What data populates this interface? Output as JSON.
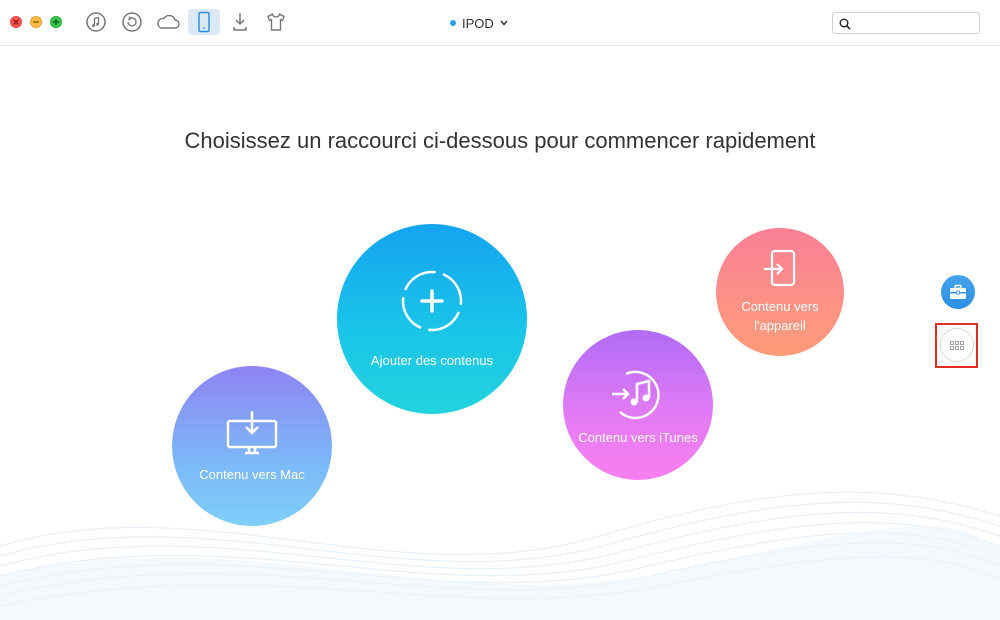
{
  "window": {
    "controls": [
      "close-icon",
      "minimize-icon",
      "maximize-icon"
    ],
    "colors": {
      "close": "#fc5753",
      "minimize": "#fdbc40",
      "maximize": "#34c84a"
    }
  },
  "toolbar": {
    "buttons": [
      {
        "icon": "music-note-icon",
        "active": false
      },
      {
        "icon": "restore-icon",
        "active": false
      },
      {
        "icon": "cloud-icon",
        "active": false
      },
      {
        "icon": "phone-icon",
        "active": true
      },
      {
        "icon": "download-icon",
        "active": false
      },
      {
        "icon": "tshirt-icon",
        "active": false
      }
    ],
    "device": {
      "name": "IPOD",
      "status_color": "#2b9ef0",
      "icon": "chevron-down-icon"
    },
    "search": {
      "value": "",
      "placeholder": "",
      "icon": "search-icon"
    }
  },
  "main": {
    "headline": "Choisissez un raccourci ci-dessous pour commencer rapidement",
    "shortcuts": [
      {
        "id": "add",
        "label": "Ajouter des contenus",
        "icon": "plus-icon",
        "colors": [
          "#14a3f0",
          "#23d3de"
        ]
      },
      {
        "id": "mac",
        "label": "Contenu vers Mac",
        "icon": "monitor-download-icon",
        "colors": [
          "#8e84f3",
          "#7fcff9"
        ]
      },
      {
        "id": "itunes",
        "label": "Contenu vers iTunes",
        "icon": "itunes-icon",
        "colors": [
          "#b06bf7",
          "#f77ff0"
        ]
      },
      {
        "id": "device",
        "label": "Contenu vers l'appareil",
        "icon": "device-import-icon",
        "colors": [
          "#fb7f97",
          "#fe9c78"
        ]
      }
    ]
  },
  "side": {
    "toolbox": {
      "icon": "toolbox-icon",
      "color": "#2c8ee0"
    },
    "grid": {
      "icon": "grid-icon",
      "highlight_color": "#e02b1f"
    }
  }
}
